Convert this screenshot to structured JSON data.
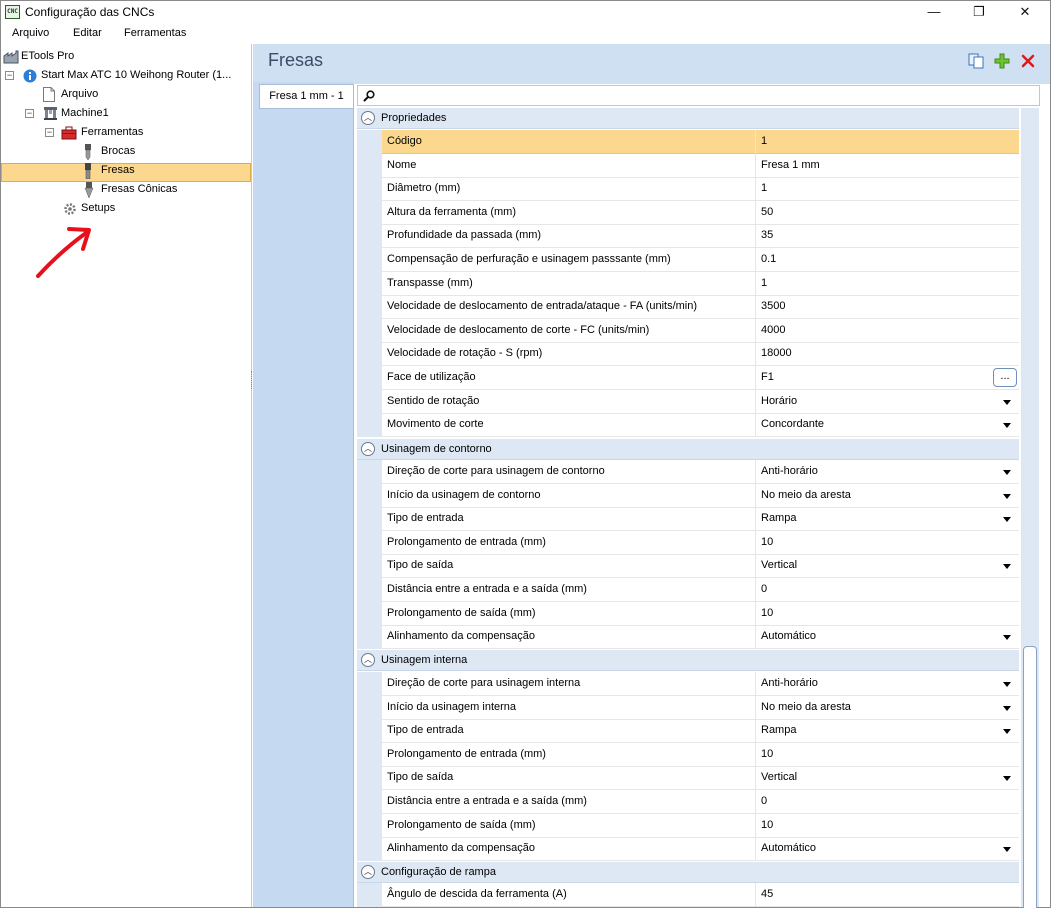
{
  "window": {
    "app_icon_text": "CNC",
    "title": "Configuração das CNCs",
    "controls": {
      "minimize": "—",
      "maximize": "❐",
      "close": "✕"
    }
  },
  "menu": [
    "Arquivo",
    "Editar",
    "Ferramentas"
  ],
  "tree": {
    "root": "ETools Pro",
    "machine_config": "Start Max ATC 10 Weihong Router (1...",
    "arquivo": "Arquivo",
    "machine": "Machine1",
    "ferramentas": "Ferramentas",
    "brocas": "Brocas",
    "fresas": "Fresas",
    "fresas_conicas": "Fresas Cônicas",
    "setups": "Setups"
  },
  "panel": {
    "title": "Fresas",
    "tab_label": "Fresa 1 mm - 1",
    "search_placeholder": ""
  },
  "categories": {
    "propriedades": "Propriedades",
    "contorno": "Usinagem de contorno",
    "interna": "Usinagem interna",
    "rampa": "Configuração de rampa"
  },
  "properties": [
    {
      "name": "Código",
      "value": "1"
    },
    {
      "name": "Nome",
      "value": "Fresa 1 mm"
    },
    {
      "name": "Diâmetro (mm)",
      "value": "1"
    },
    {
      "name": "Altura da ferramenta (mm)",
      "value": "50"
    },
    {
      "name": "Profundidade da passada (mm)",
      "value": "35"
    },
    {
      "name": "Compensação de perfuração e usinagem passsante (mm)",
      "value": "0.1"
    },
    {
      "name": "Transpasse (mm)",
      "value": "1"
    },
    {
      "name": "Velocidade de deslocamento de entrada/ataque - FA (units/min)",
      "value": "3500"
    },
    {
      "name": "Velocidade de deslocamento de corte - FC (units/min)",
      "value": "4000"
    },
    {
      "name": "Velocidade de rotação - S (rpm)",
      "value": "18000"
    },
    {
      "name": "Face de utilização",
      "value": "F1",
      "button": "..."
    },
    {
      "name": "Sentido de rotação",
      "value": "Horário"
    },
    {
      "name": "Movimento de corte",
      "value": "Concordante"
    }
  ],
  "contorno": [
    {
      "name": "Direção de corte para usinagem de contorno",
      "value": "Anti-horário"
    },
    {
      "name": "Início da usinagem de contorno",
      "value": "No meio da aresta"
    },
    {
      "name": "Tipo de entrada",
      "value": "Rampa"
    },
    {
      "name": "Prolongamento de entrada (mm)",
      "value": "10"
    },
    {
      "name": "Tipo de saída",
      "value": "Vertical"
    },
    {
      "name": "Distância entre a entrada e a saída (mm)",
      "value": "0"
    },
    {
      "name": "Prolongamento de saída (mm)",
      "value": "10"
    },
    {
      "name": "Alinhamento da compensação",
      "value": "Automático"
    }
  ],
  "interna": [
    {
      "name": "Direção de corte para usinagem interna",
      "value": "Anti-horário"
    },
    {
      "name": "Início da usinagem interna",
      "value": "No meio da aresta"
    },
    {
      "name": "Tipo de entrada",
      "value": "Rampa"
    },
    {
      "name": "Prolongamento de entrada (mm)",
      "value": "10"
    },
    {
      "name": "Tipo de saída",
      "value": "Vertical"
    },
    {
      "name": "Distância entre a entrada e a saída (mm)",
      "value": "0"
    },
    {
      "name": "Prolongamento de saída (mm)",
      "value": "10"
    },
    {
      "name": "Alinhamento da compensação",
      "value": "Automático"
    }
  ],
  "rampa": [
    {
      "name": "Ângulo de descida da ferramenta (A)",
      "value": "45"
    }
  ],
  "colors": {
    "selection": "#fcd88f",
    "panel_bg": "#cfe0f3",
    "annotation": "#e8101b"
  }
}
